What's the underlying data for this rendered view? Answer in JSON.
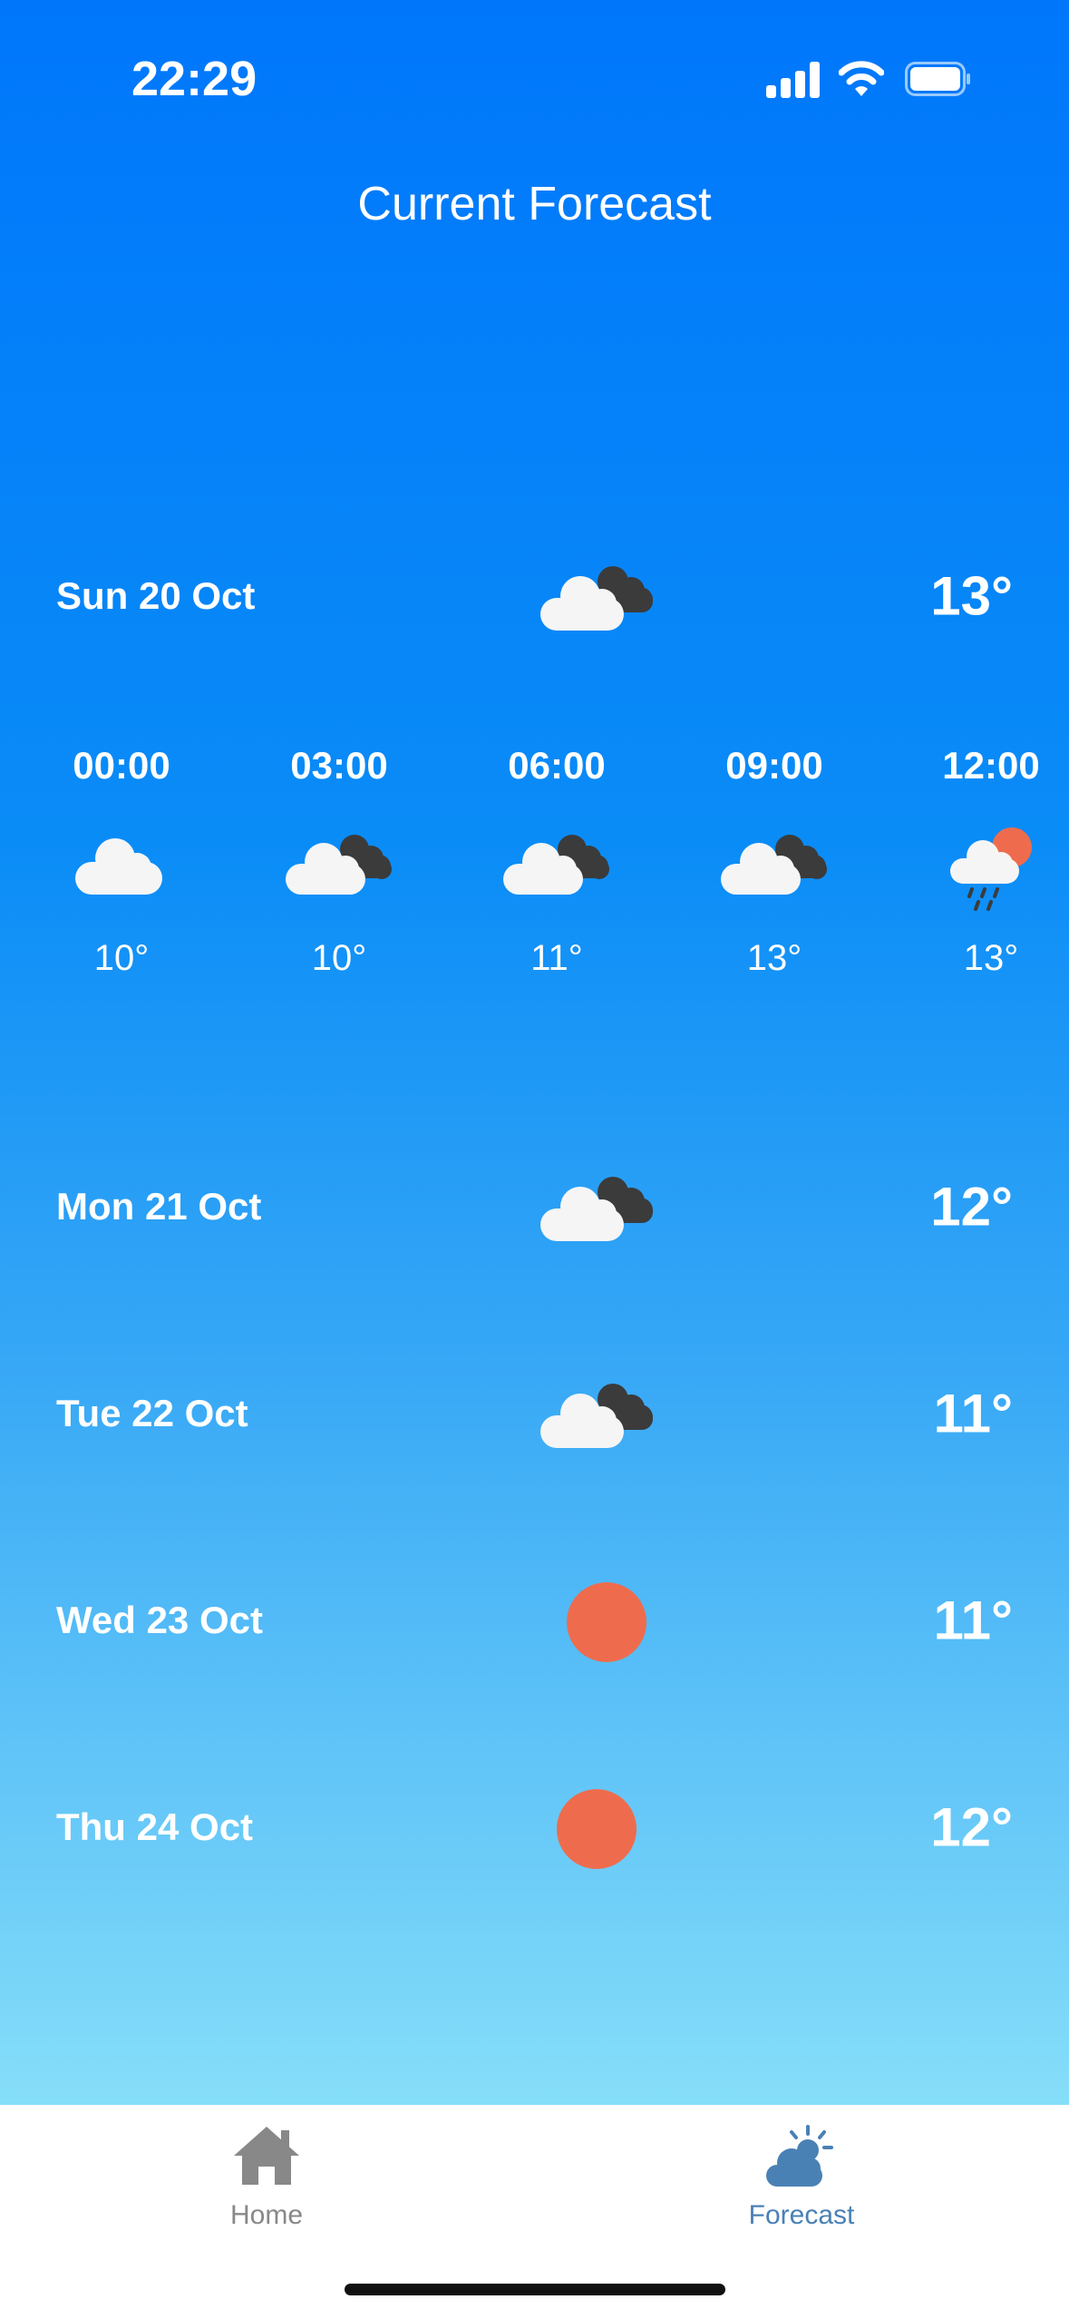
{
  "status_bar": {
    "time": "22:29",
    "icons": [
      "signal-icon",
      "wifi-icon",
      "battery-icon"
    ]
  },
  "header": {
    "title": "Current Forecast"
  },
  "today": {
    "date": "Sun 20 Oct",
    "icon": "cloudy-icon",
    "temp": "13°"
  },
  "hourly": [
    {
      "time": "00:00",
      "icon": "cloud-icon",
      "temp": "10°"
    },
    {
      "time": "03:00",
      "icon": "cloudy-icon",
      "temp": "10°"
    },
    {
      "time": "06:00",
      "icon": "cloudy-icon",
      "temp": "11°"
    },
    {
      "time": "09:00",
      "icon": "cloudy-icon",
      "temp": "13°"
    },
    {
      "time": "12:00",
      "icon": "sun-rain-icon",
      "temp": "13°"
    }
  ],
  "days": [
    {
      "date": "Mon 21 Oct",
      "icon": "cloudy-icon",
      "temp": "12°"
    },
    {
      "date": "Tue 22 Oct",
      "icon": "cloudy-icon",
      "temp": "11°"
    },
    {
      "date": "Wed 23 Oct",
      "icon": "sun-icon",
      "temp": "11°"
    },
    {
      "date": "Thu 24 Oct",
      "icon": "sun-icon",
      "temp": "12°"
    }
  ],
  "tabbar": {
    "home_label": "Home",
    "forecast_label": "Forecast",
    "active": "forecast"
  },
  "colors": {
    "sun": "#ee6c4d",
    "active_tab": "#4a81b5",
    "inactive_tab": "#888888"
  }
}
